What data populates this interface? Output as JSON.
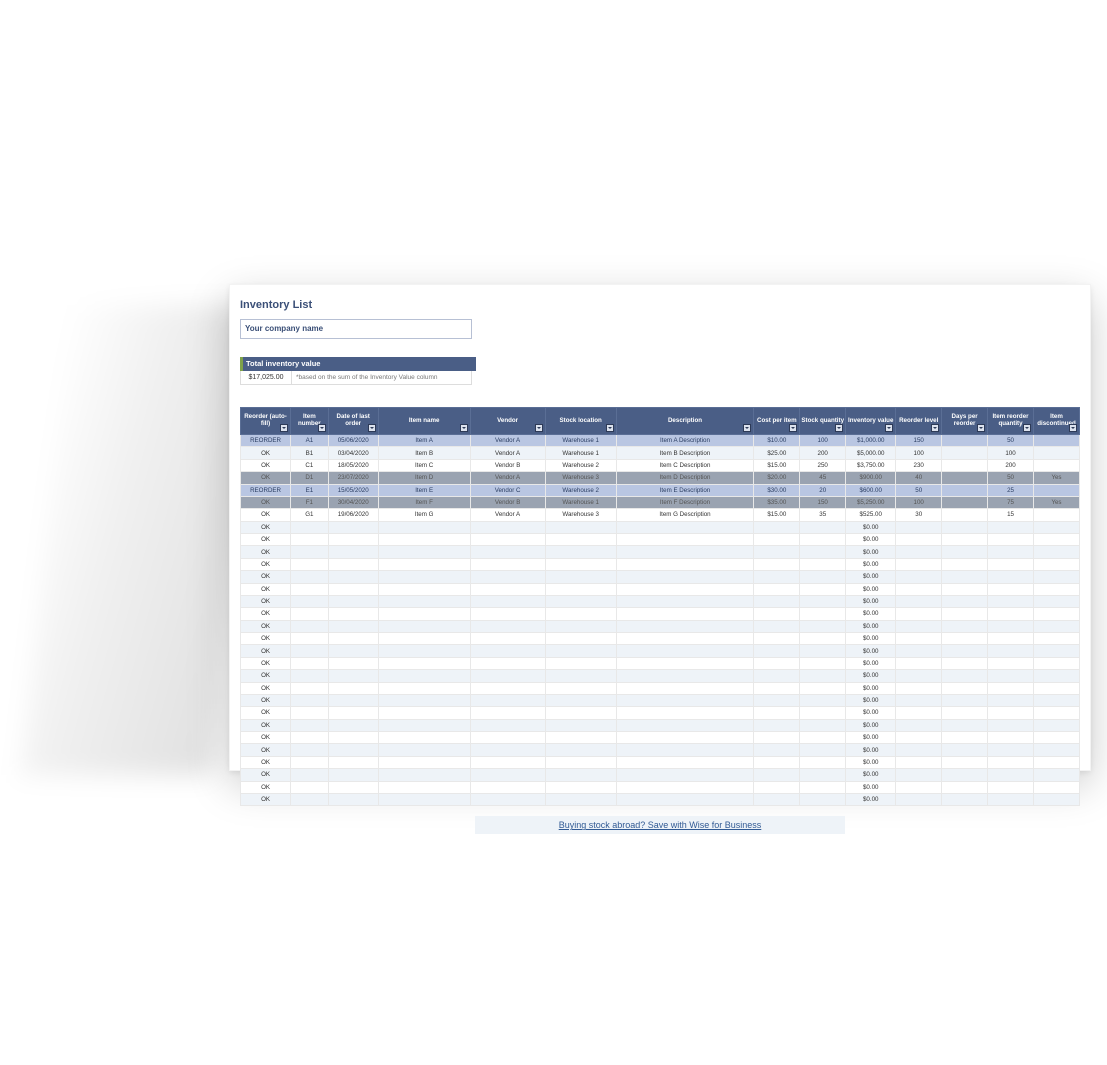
{
  "title": "Inventory List",
  "company_placeholder": "Your company name",
  "total_inventory": {
    "label": "Total inventory value",
    "value": "$17,025.00",
    "note": "*based on the sum of the Inventory Value column"
  },
  "columns": [
    "Reorder (auto-fill)",
    "Item number",
    "Date of last order",
    "Item name",
    "Vendor",
    "Stock location",
    "Description",
    "Cost per item",
    "Stock quantity",
    "Inventory value",
    "Reorder level",
    "Days per reorder",
    "Item reorder quantity",
    "Item discontinued"
  ],
  "rows": [
    {
      "status": "REORDER",
      "num": "A1",
      "date": "05/06/2020",
      "name": "Item A",
      "vendor": "Vendor A",
      "loc": "Warehouse 1",
      "desc": "Item A Description",
      "cost": "$10.00",
      "qty": "100",
      "val": "$1,000.00",
      "lvl": "150",
      "days": "",
      "rqty": "50",
      "disc": "",
      "style": "highlight"
    },
    {
      "status": "OK",
      "num": "B1",
      "date": "03/04/2020",
      "name": "Item B",
      "vendor": "Vendor A",
      "loc": "Warehouse 1",
      "desc": "Item B Description",
      "cost": "$25.00",
      "qty": "200",
      "val": "$5,000.00",
      "lvl": "100",
      "days": "",
      "rqty": "100",
      "disc": "",
      "style": ""
    },
    {
      "status": "OK",
      "num": "C1",
      "date": "18/05/2020",
      "name": "Item C",
      "vendor": "Vendor B",
      "loc": "Warehouse 2",
      "desc": "Item C Description",
      "cost": "$15.00",
      "qty": "250",
      "val": "$3,750.00",
      "lvl": "230",
      "days": "",
      "rqty": "200",
      "disc": "",
      "style": ""
    },
    {
      "status": "OK",
      "num": "D1",
      "date": "23/07/2020",
      "name": "Item D",
      "vendor": "Vendor A",
      "loc": "Warehouse 3",
      "desc": "Item D Description",
      "cost": "$20.00",
      "qty": "45",
      "val": "$900.00",
      "lvl": "40",
      "days": "",
      "rqty": "50",
      "disc": "Yes",
      "style": "disc"
    },
    {
      "status": "REORDER",
      "num": "E1",
      "date": "15/05/2020",
      "name": "Item E",
      "vendor": "Vendor C",
      "loc": "Warehouse 2",
      "desc": "Item E Description",
      "cost": "$30.00",
      "qty": "20",
      "val": "$600.00",
      "lvl": "50",
      "days": "",
      "rqty": "25",
      "disc": "",
      "style": "highlight"
    },
    {
      "status": "OK",
      "num": "F1",
      "date": "30/04/2020",
      "name": "Item F",
      "vendor": "Vendor B",
      "loc": "Warehouse 1",
      "desc": "Item F Description",
      "cost": "$35.00",
      "qty": "150",
      "val": "$5,250.00",
      "lvl": "100",
      "days": "",
      "rqty": "75",
      "disc": "Yes",
      "style": "disc"
    },
    {
      "status": "OK",
      "num": "G1",
      "date": "19/06/2020",
      "name": "Item G",
      "vendor": "Vendor A",
      "loc": "Warehouse 3",
      "desc": "Item G Description",
      "cost": "$15.00",
      "qty": "35",
      "val": "$525.00",
      "lvl": "30",
      "days": "",
      "rqty": "15",
      "disc": "",
      "style": ""
    },
    {
      "status": "OK",
      "num": "",
      "date": "",
      "name": "",
      "vendor": "",
      "loc": "",
      "desc": "",
      "cost": "",
      "qty": "",
      "val": "$0.00",
      "lvl": "",
      "days": "",
      "rqty": "",
      "disc": "",
      "style": ""
    },
    {
      "status": "OK",
      "num": "",
      "date": "",
      "name": "",
      "vendor": "",
      "loc": "",
      "desc": "",
      "cost": "",
      "qty": "",
      "val": "$0.00",
      "lvl": "",
      "days": "",
      "rqty": "",
      "disc": "",
      "style": ""
    },
    {
      "status": "OK",
      "num": "",
      "date": "",
      "name": "",
      "vendor": "",
      "loc": "",
      "desc": "",
      "cost": "",
      "qty": "",
      "val": "$0.00",
      "lvl": "",
      "days": "",
      "rqty": "",
      "disc": "",
      "style": ""
    },
    {
      "status": "OK",
      "num": "",
      "date": "",
      "name": "",
      "vendor": "",
      "loc": "",
      "desc": "",
      "cost": "",
      "qty": "",
      "val": "$0.00",
      "lvl": "",
      "days": "",
      "rqty": "",
      "disc": "",
      "style": ""
    },
    {
      "status": "OK",
      "num": "",
      "date": "",
      "name": "",
      "vendor": "",
      "loc": "",
      "desc": "",
      "cost": "",
      "qty": "",
      "val": "$0.00",
      "lvl": "",
      "days": "",
      "rqty": "",
      "disc": "",
      "style": ""
    },
    {
      "status": "OK",
      "num": "",
      "date": "",
      "name": "",
      "vendor": "",
      "loc": "",
      "desc": "",
      "cost": "",
      "qty": "",
      "val": "$0.00",
      "lvl": "",
      "days": "",
      "rqty": "",
      "disc": "",
      "style": ""
    },
    {
      "status": "OK",
      "num": "",
      "date": "",
      "name": "",
      "vendor": "",
      "loc": "",
      "desc": "",
      "cost": "",
      "qty": "",
      "val": "$0.00",
      "lvl": "",
      "days": "",
      "rqty": "",
      "disc": "",
      "style": ""
    },
    {
      "status": "OK",
      "num": "",
      "date": "",
      "name": "",
      "vendor": "",
      "loc": "",
      "desc": "",
      "cost": "",
      "qty": "",
      "val": "$0.00",
      "lvl": "",
      "days": "",
      "rqty": "",
      "disc": "",
      "style": ""
    },
    {
      "status": "OK",
      "num": "",
      "date": "",
      "name": "",
      "vendor": "",
      "loc": "",
      "desc": "",
      "cost": "",
      "qty": "",
      "val": "$0.00",
      "lvl": "",
      "days": "",
      "rqty": "",
      "disc": "",
      "style": ""
    },
    {
      "status": "OK",
      "num": "",
      "date": "",
      "name": "",
      "vendor": "",
      "loc": "",
      "desc": "",
      "cost": "",
      "qty": "",
      "val": "$0.00",
      "lvl": "",
      "days": "",
      "rqty": "",
      "disc": "",
      "style": ""
    },
    {
      "status": "OK",
      "num": "",
      "date": "",
      "name": "",
      "vendor": "",
      "loc": "",
      "desc": "",
      "cost": "",
      "qty": "",
      "val": "$0.00",
      "lvl": "",
      "days": "",
      "rqty": "",
      "disc": "",
      "style": ""
    },
    {
      "status": "OK",
      "num": "",
      "date": "",
      "name": "",
      "vendor": "",
      "loc": "",
      "desc": "",
      "cost": "",
      "qty": "",
      "val": "$0.00",
      "lvl": "",
      "days": "",
      "rqty": "",
      "disc": "",
      "style": ""
    },
    {
      "status": "OK",
      "num": "",
      "date": "",
      "name": "",
      "vendor": "",
      "loc": "",
      "desc": "",
      "cost": "",
      "qty": "",
      "val": "$0.00",
      "lvl": "",
      "days": "",
      "rqty": "",
      "disc": "",
      "style": ""
    },
    {
      "status": "OK",
      "num": "",
      "date": "",
      "name": "",
      "vendor": "",
      "loc": "",
      "desc": "",
      "cost": "",
      "qty": "",
      "val": "$0.00",
      "lvl": "",
      "days": "",
      "rqty": "",
      "disc": "",
      "style": ""
    },
    {
      "status": "OK",
      "num": "",
      "date": "",
      "name": "",
      "vendor": "",
      "loc": "",
      "desc": "",
      "cost": "",
      "qty": "",
      "val": "$0.00",
      "lvl": "",
      "days": "",
      "rqty": "",
      "disc": "",
      "style": ""
    },
    {
      "status": "OK",
      "num": "",
      "date": "",
      "name": "",
      "vendor": "",
      "loc": "",
      "desc": "",
      "cost": "",
      "qty": "",
      "val": "$0.00",
      "lvl": "",
      "days": "",
      "rqty": "",
      "disc": "",
      "style": ""
    },
    {
      "status": "OK",
      "num": "",
      "date": "",
      "name": "",
      "vendor": "",
      "loc": "",
      "desc": "",
      "cost": "",
      "qty": "",
      "val": "$0.00",
      "lvl": "",
      "days": "",
      "rqty": "",
      "disc": "",
      "style": ""
    },
    {
      "status": "OK",
      "num": "",
      "date": "",
      "name": "",
      "vendor": "",
      "loc": "",
      "desc": "",
      "cost": "",
      "qty": "",
      "val": "$0.00",
      "lvl": "",
      "days": "",
      "rqty": "",
      "disc": "",
      "style": ""
    },
    {
      "status": "OK",
      "num": "",
      "date": "",
      "name": "",
      "vendor": "",
      "loc": "",
      "desc": "",
      "cost": "",
      "qty": "",
      "val": "$0.00",
      "lvl": "",
      "days": "",
      "rqty": "",
      "disc": "",
      "style": ""
    },
    {
      "status": "OK",
      "num": "",
      "date": "",
      "name": "",
      "vendor": "",
      "loc": "",
      "desc": "",
      "cost": "",
      "qty": "",
      "val": "$0.00",
      "lvl": "",
      "days": "",
      "rqty": "",
      "disc": "",
      "style": ""
    },
    {
      "status": "OK",
      "num": "",
      "date": "",
      "name": "",
      "vendor": "",
      "loc": "",
      "desc": "",
      "cost": "",
      "qty": "",
      "val": "$0.00",
      "lvl": "",
      "days": "",
      "rqty": "",
      "disc": "",
      "style": ""
    },
    {
      "status": "OK",
      "num": "",
      "date": "",
      "name": "",
      "vendor": "",
      "loc": "",
      "desc": "",
      "cost": "",
      "qty": "",
      "val": "$0.00",
      "lvl": "",
      "days": "",
      "rqty": "",
      "disc": "",
      "style": ""
    },
    {
      "status": "OK",
      "num": "",
      "date": "",
      "name": "",
      "vendor": "",
      "loc": "",
      "desc": "",
      "cost": "",
      "qty": "",
      "val": "$0.00",
      "lvl": "",
      "days": "",
      "rqty": "",
      "disc": "",
      "style": ""
    }
  ],
  "footer_link": "Buying stock abroad? Save with Wise for Business",
  "chart_data": {
    "type": "table",
    "title": "Inventory List",
    "columns": [
      "Reorder (auto-fill)",
      "Item number",
      "Date of last order",
      "Item name",
      "Vendor",
      "Stock location",
      "Description",
      "Cost per item",
      "Stock quantity",
      "Inventory value",
      "Reorder level",
      "Days per reorder",
      "Item reorder quantity",
      "Item discontinued"
    ],
    "rows": [
      [
        "REORDER",
        "A1",
        "05/06/2020",
        "Item A",
        "Vendor A",
        "Warehouse 1",
        "Item A Description",
        10.0,
        100,
        1000.0,
        150,
        null,
        50,
        null
      ],
      [
        "OK",
        "B1",
        "03/04/2020",
        "Item B",
        "Vendor A",
        "Warehouse 1",
        "Item B Description",
        25.0,
        200,
        5000.0,
        100,
        null,
        100,
        null
      ],
      [
        "OK",
        "C1",
        "18/05/2020",
        "Item C",
        "Vendor B",
        "Warehouse 2",
        "Item C Description",
        15.0,
        250,
        3750.0,
        230,
        null,
        200,
        null
      ],
      [
        "OK",
        "D1",
        "23/07/2020",
        "Item D",
        "Vendor A",
        "Warehouse 3",
        "Item D Description",
        20.0,
        45,
        900.0,
        40,
        null,
        50,
        "Yes"
      ],
      [
        "REORDER",
        "E1",
        "15/05/2020",
        "Item E",
        "Vendor C",
        "Warehouse 2",
        "Item E Description",
        30.0,
        20,
        600.0,
        50,
        null,
        25,
        null
      ],
      [
        "OK",
        "F1",
        "30/04/2020",
        "Item F",
        "Vendor B",
        "Warehouse 1",
        "Item F Description",
        35.0,
        150,
        5250.0,
        100,
        null,
        75,
        "Yes"
      ],
      [
        "OK",
        "G1",
        "19/06/2020",
        "Item G",
        "Vendor A",
        "Warehouse 3",
        "Item G Description",
        15.0,
        35,
        525.0,
        30,
        null,
        15,
        null
      ]
    ],
    "total_inventory_value": 17025.0
  }
}
